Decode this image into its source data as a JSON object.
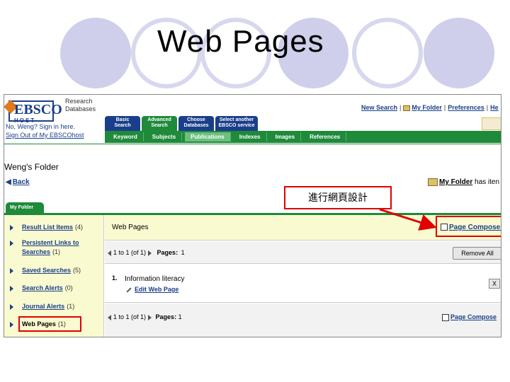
{
  "slide": {
    "title": "Web Pages"
  },
  "header": {
    "logo_text": "EBSCO",
    "logo_sub": "HOST",
    "tagline_line1": "Research",
    "tagline_line2": "Databases",
    "links": [
      "New Search",
      "My Folder",
      "Preferences",
      "He"
    ],
    "user_text": "No, Weng? Sign in here.",
    "signout": "Sign Out of My EBSCOhost"
  },
  "tabs_top": [
    {
      "line1": "Basic",
      "line2": "Search"
    },
    {
      "line1": "Advanced",
      "line2": "Search"
    },
    {
      "line1": "Choose",
      "line2": "Databases"
    },
    {
      "line1": "Select another",
      "line2": "EBSCO service"
    }
  ],
  "nav": [
    "Keyword",
    "Subjects",
    "Publications",
    "Indexes",
    "Images",
    "References"
  ],
  "folder": {
    "title": "Weng's Folder",
    "back": "Back",
    "right_label": "My Folder",
    "right_suffix": " has iten",
    "tab": "My Folder"
  },
  "annotation": "進行網頁設計",
  "sidebar": [
    {
      "label": "Result List Items",
      "count": "(4)"
    },
    {
      "label": "Persistent Links to",
      "label2": "Searches",
      "count": "(1)"
    },
    {
      "label": "Saved Searches",
      "count": "(5)"
    },
    {
      "label": "Search Alerts",
      "count": "(0)"
    },
    {
      "label": "Journal Alerts",
      "count": "(1)"
    },
    {
      "label": "Web Pages",
      "count": "(1)"
    }
  ],
  "main": {
    "section_title": "Web Pages",
    "composer": "Page Composer",
    "composer2": "Page Compose",
    "pager_range": "1 to 1 (of 1)",
    "pager_pages_label": "Pages:",
    "pager_page": "1",
    "remove_all": "Remove All",
    "item_number": "1.",
    "item_title": "Information literacy",
    "edit_link": "Edit Web Page",
    "remove_x": "X"
  },
  "colors": {
    "ebsco_blue": "#1a3f8a",
    "ebsco_green": "#1e8a3a",
    "highlight_red": "#e00000",
    "sidebar_yellow": "#fafad0"
  }
}
